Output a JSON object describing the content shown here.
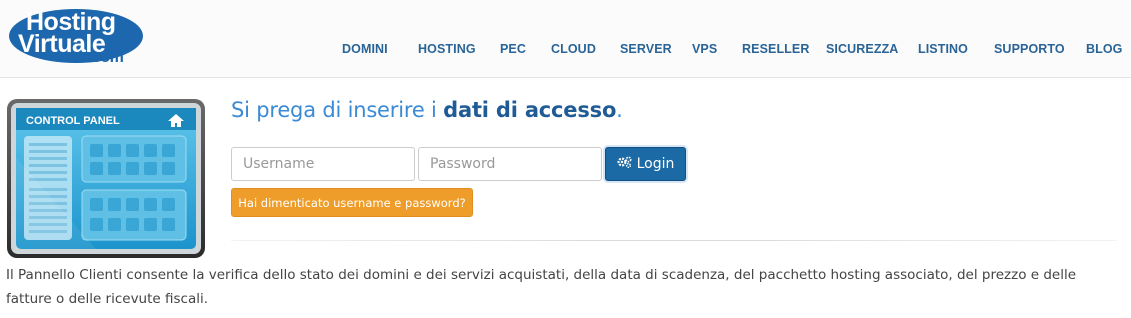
{
  "logo": {
    "line1": "Hosting",
    "line2": "Virtuale",
    "line3": ".com"
  },
  "nav": [
    {
      "label": "DOMINI"
    },
    {
      "label": "HOSTING"
    },
    {
      "label": "PEC"
    },
    {
      "label": "CLOUD"
    },
    {
      "label": "SERVER"
    },
    {
      "label": "VPS"
    },
    {
      "label": "RESELLER"
    },
    {
      "label": "SICUREZZA"
    },
    {
      "label": "LISTINO"
    },
    {
      "label": "SUPPORTO"
    },
    {
      "label": "BLOG"
    }
  ],
  "illustration": {
    "title": "CONTROL PANEL",
    "icon": "home-icon"
  },
  "login": {
    "heading_prefix": "Si prega di inserire i ",
    "heading_bold": "dati di accesso",
    "heading_suffix": ".",
    "username_placeholder": "Username",
    "password_placeholder": "Password",
    "login_label": "Login",
    "login_icon": "gears-icon",
    "forgot_label": "Hai dimenticato username e password?"
  },
  "description": "Il Pannello Clienti consente la verifica dello stato dei domini e dei servizi acquistati, della data di scadenza, del pacchetto hosting associato, del prezzo e delle fatture o delle ricevute fiscali.",
  "colors": {
    "nav_text": "#2a6496",
    "heading": "#3a8ad6",
    "login_button": "#1b6aa6",
    "forgot_button": "#ef9d2a"
  }
}
